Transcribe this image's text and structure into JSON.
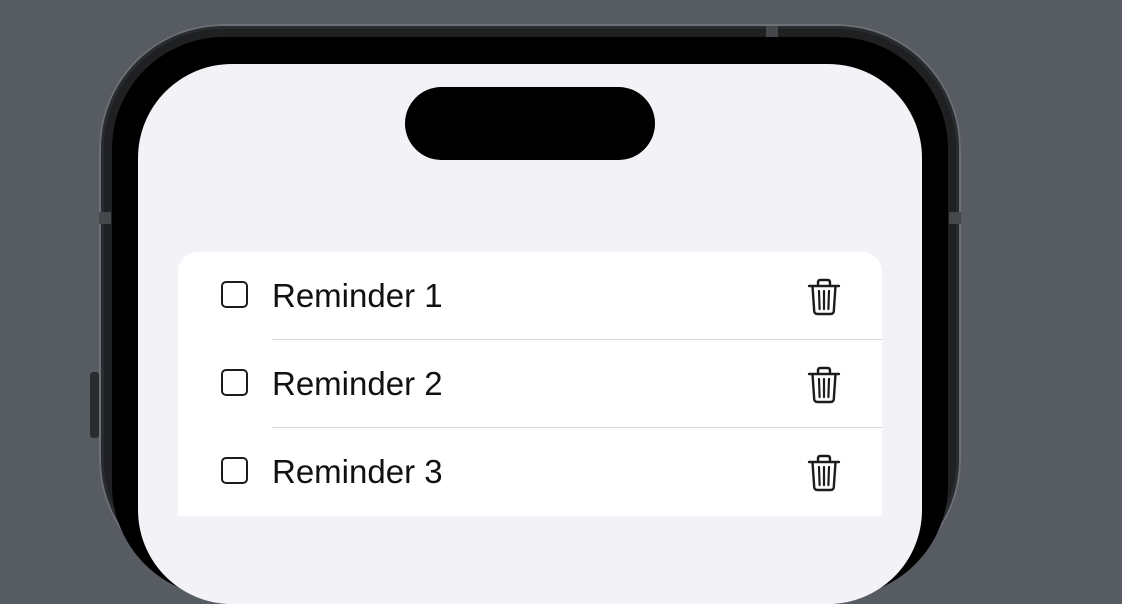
{
  "reminders": {
    "items": [
      {
        "title": "Reminder 1",
        "checked": false,
        "checkbox_icon": "square-icon",
        "delete_icon": "trash-icon"
      },
      {
        "title": "Reminder 2",
        "checked": false,
        "checkbox_icon": "square-icon",
        "delete_icon": "trash-icon"
      },
      {
        "title": "Reminder 3",
        "checked": false,
        "checkbox_icon": "square-icon",
        "delete_icon": "trash-icon"
      }
    ]
  },
  "colors": {
    "background": "#575c63",
    "screen_background": "#f2f2f7",
    "card_background": "#ffffff",
    "text": "#111111",
    "separator": "#d8d8dc",
    "icon": "#1c1c1e",
    "bezel": "#000000"
  }
}
